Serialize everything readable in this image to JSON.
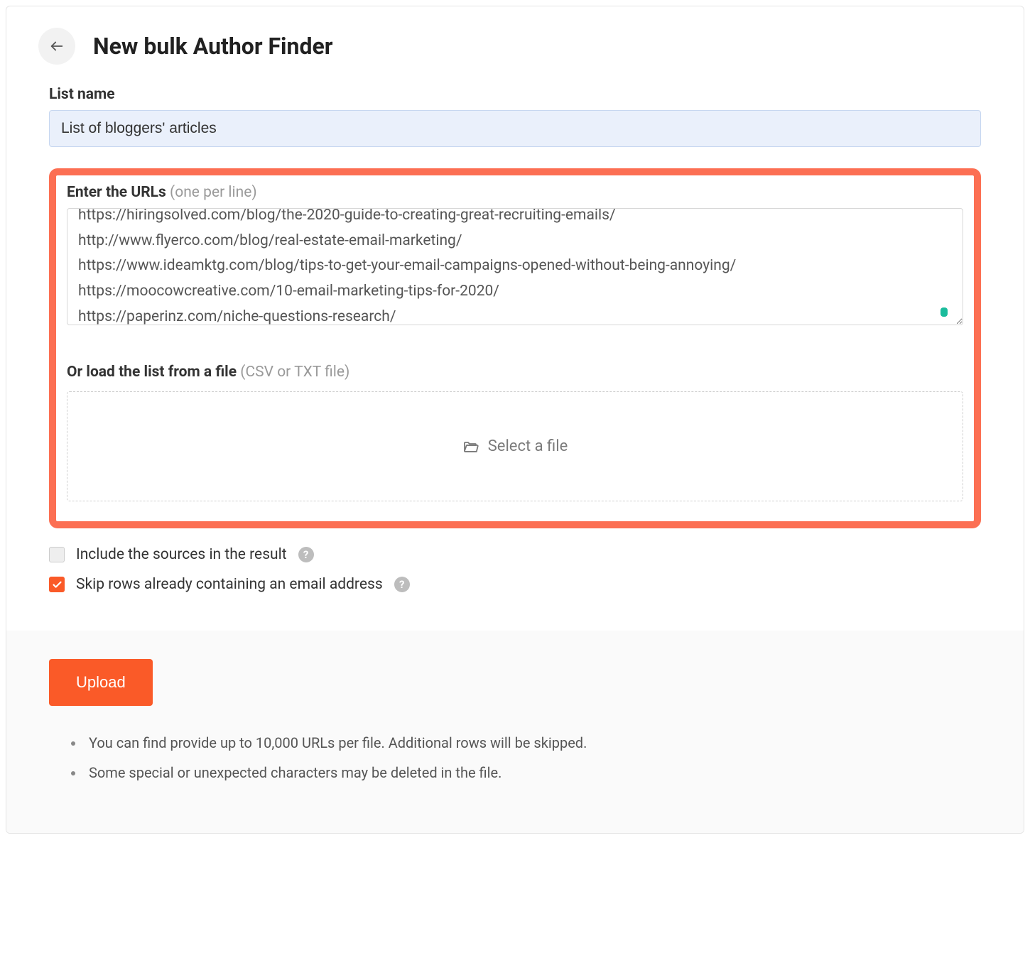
{
  "header": {
    "title": "New bulk Author Finder"
  },
  "list_name": {
    "label": "List name",
    "value": "List of bloggers' articles"
  },
  "urls": {
    "label": "Enter the URLs",
    "hint": "(one per line)",
    "value": "https://hiringsolved.com/blog/the-2020-guide-to-creating-great-recruiting-emails/\nhttp://www.flyerco.com/blog/real-estate-email-marketing/\nhttps://www.ideamktg.com/blog/tips-to-get-your-email-campaigns-opened-without-being-annoying/\nhttps://moocowcreative.com/10-email-marketing-tips-for-2020/\nhttps://paperinz.com/niche-questions-research/"
  },
  "file": {
    "label": "Or load the list from a file",
    "hint": "(CSV or TXT file)",
    "dropzone_text": "Select a file"
  },
  "options": {
    "include_sources": {
      "label": "Include the sources in the result",
      "checked": false
    },
    "skip_rows": {
      "label": "Skip rows already containing an email address",
      "checked": true
    }
  },
  "upload_label": "Upload",
  "notes": [
    "You can find provide up to 10,000 URLs per file. Additional rows will be skipped.",
    "Some special or unexpected characters may be deleted in the file."
  ]
}
